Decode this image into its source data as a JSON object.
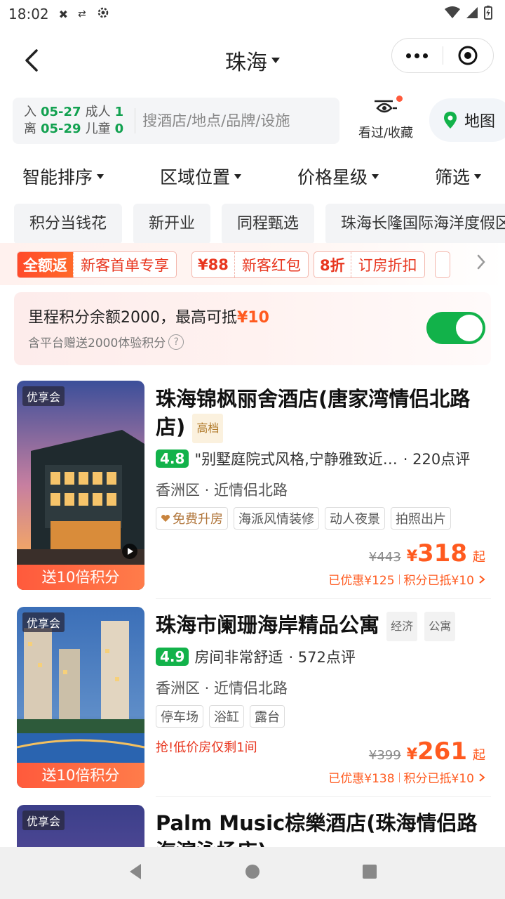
{
  "status_bar": {
    "time": "18:02"
  },
  "nav": {
    "city": "珠海"
  },
  "search": {
    "checkin_label": "入",
    "checkin_date": "05-27",
    "checkout_label": "离",
    "checkout_date": "05-29",
    "adults_label": "成人",
    "adults": "1",
    "children_label": "儿童",
    "children": "0",
    "placeholder": "搜酒店/地点/品牌/设施",
    "favorites_label": "看过/收藏",
    "map_label": "地图"
  },
  "filters": [
    "智能排序",
    "区域位置",
    "价格星级",
    "筛选"
  ],
  "quick_tags": [
    "积分当钱花",
    "新开业",
    "同程甄选",
    "珠海长隆国际海洋度假区"
  ],
  "promos": [
    {
      "left": "全额返",
      "right": "新客首单专享"
    },
    {
      "left": "¥88",
      "right": "新客红包"
    },
    {
      "left": "8折",
      "right": "订房折扣"
    }
  ],
  "miles": {
    "title_prefix": "里程积分余额2000，最高可抵",
    "title_amount": "¥10",
    "subtitle": "含平台赠送2000体验积分",
    "enabled": true
  },
  "hotels": [
    {
      "member_badge": "优享会",
      "points_badge": "送10倍积分",
      "name": "珠海锦枫丽舍酒店(唐家湾情侣北路店)",
      "grades": [
        "高档"
      ],
      "score": "4.8",
      "review_quote": "\"别墅庭院式风格,宁静雅致近…",
      "review_count": "· 220点评",
      "location": "香洲区 · 近情侣北路",
      "upgrade_tag": "免费升房",
      "tags": [
        "海派风情装修",
        "动人夜景",
        "拍照出片"
      ],
      "urgent": "",
      "original_price": "¥443",
      "currency": "¥",
      "price": "318",
      "price_suffix": "起",
      "discount": "已优惠¥125",
      "points_discount": "积分已抵¥10"
    },
    {
      "member_badge": "优享会",
      "points_badge": "送10倍积分",
      "name": "珠海市阑珊海岸精品公寓",
      "grades": [
        "经济",
        "公寓"
      ],
      "score": "4.9",
      "review_quote": "房间非常舒适",
      "review_count": "· 572点评",
      "location": "香洲区 · 近情侣北路",
      "tags": [
        "停车场",
        "浴缸",
        "露台"
      ],
      "urgent": "抢!低价房仅剩1间",
      "original_price": "¥399",
      "currency": "¥",
      "price": "261",
      "price_suffix": "起",
      "discount": "已优惠¥138",
      "points_discount": "积分已抵¥10"
    },
    {
      "member_badge": "优享会",
      "name": "Palm Music棕樂酒店(珠海情侣路海滨泳场店)"
    }
  ],
  "colors": {
    "brand_green": "#12b24a",
    "price_orange": "#ff5a1f",
    "promo_red": "#e8361f"
  }
}
